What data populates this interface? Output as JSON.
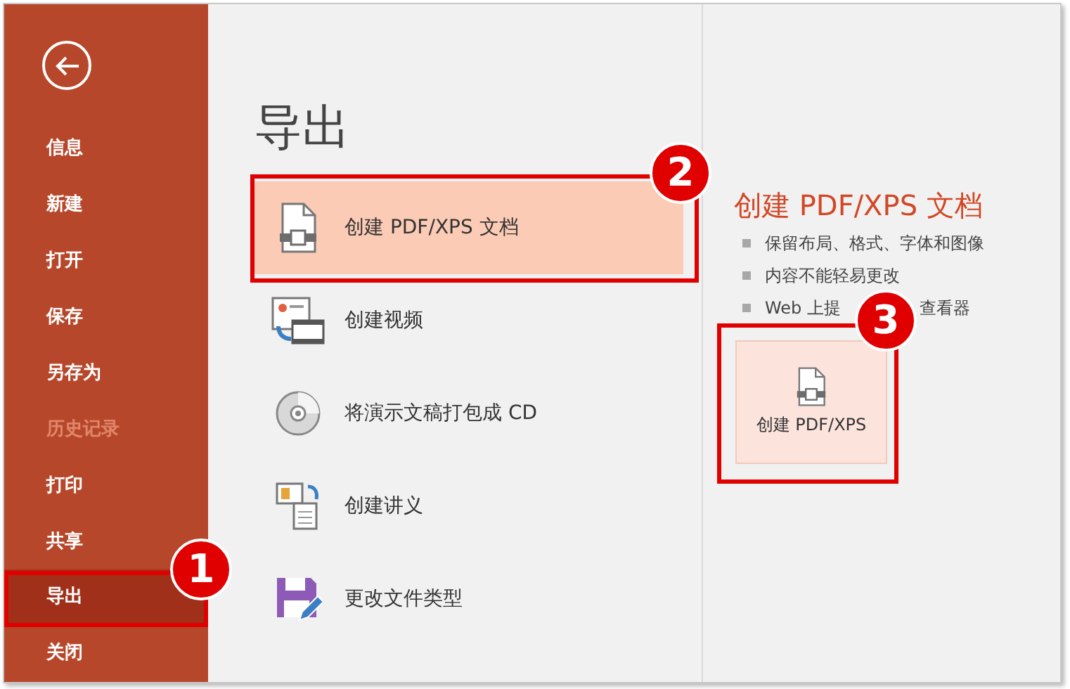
{
  "sidebar": {
    "items": [
      {
        "label": "信息",
        "selected": false,
        "disabled": false
      },
      {
        "label": "新建",
        "selected": false,
        "disabled": false
      },
      {
        "label": "打开",
        "selected": false,
        "disabled": false
      },
      {
        "label": "保存",
        "selected": false,
        "disabled": false
      },
      {
        "label": "另存为",
        "selected": false,
        "disabled": false
      },
      {
        "label": "历史记录",
        "selected": false,
        "disabled": true
      },
      {
        "label": "打印",
        "selected": false,
        "disabled": false
      },
      {
        "label": "共享",
        "selected": false,
        "disabled": false
      },
      {
        "label": "导出",
        "selected": true,
        "disabled": false
      },
      {
        "label": "关闭",
        "selected": false,
        "disabled": false
      }
    ]
  },
  "main": {
    "title": "导出",
    "options": [
      {
        "label": "创建 PDF/XPS 文档",
        "selected": true,
        "kind": "pdf"
      },
      {
        "label": "创建视频",
        "selected": false,
        "kind": "video"
      },
      {
        "label": "将演示文稿打包成 CD",
        "selected": false,
        "kind": "cd"
      },
      {
        "label": "创建讲义",
        "selected": false,
        "kind": "handout"
      },
      {
        "label": "更改文件类型",
        "selected": false,
        "kind": "filetype"
      }
    ]
  },
  "detail": {
    "title": "创建 PDF/XPS 文档",
    "bullets": [
      {
        "segments": [
          "保留布局、格式、字体和图像"
        ]
      },
      {
        "segments": [
          "内容不能轻易更改"
        ]
      },
      {
        "segments": [
          "Web 上提",
          "查看器"
        ]
      }
    ],
    "button": "创建 PDF/XPS"
  },
  "annotations": [
    {
      "label": "1"
    },
    {
      "label": "2"
    },
    {
      "label": "3"
    }
  ]
}
